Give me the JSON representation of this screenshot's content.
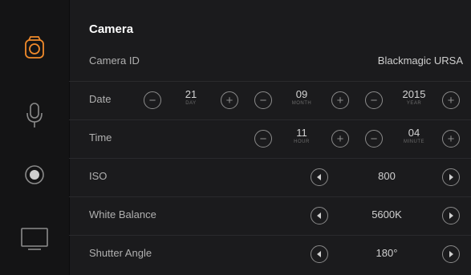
{
  "sidebar": {
    "items": [
      {
        "name": "camera-settings",
        "icon": "camera-icon",
        "active": true
      },
      {
        "name": "audio-settings",
        "icon": "microphone-icon",
        "active": false
      },
      {
        "name": "record-settings",
        "icon": "record-icon",
        "active": false
      },
      {
        "name": "display-settings",
        "icon": "monitor-icon",
        "active": false
      }
    ]
  },
  "section": {
    "title": "Camera"
  },
  "camera_id": {
    "label": "Camera ID",
    "value": "Blackmagic URSA"
  },
  "date": {
    "label": "Date",
    "day": {
      "value": "21",
      "unit": "DAY"
    },
    "month": {
      "value": "09",
      "unit": "MONTH"
    },
    "year": {
      "value": "2015",
      "unit": "YEAR"
    }
  },
  "time": {
    "label": "Time",
    "hour": {
      "value": "11",
      "unit": "HOUR"
    },
    "minute": {
      "value": "04",
      "unit": "MINUTE"
    }
  },
  "iso": {
    "label": "ISO",
    "value": "800"
  },
  "white_balance": {
    "label": "White Balance",
    "value": "5600K"
  },
  "shutter_angle": {
    "label": "Shutter Angle",
    "value": "180°"
  },
  "colors": {
    "accent": "#f08a2b",
    "background": "#1b1b1d",
    "sidebar": "#141415"
  }
}
